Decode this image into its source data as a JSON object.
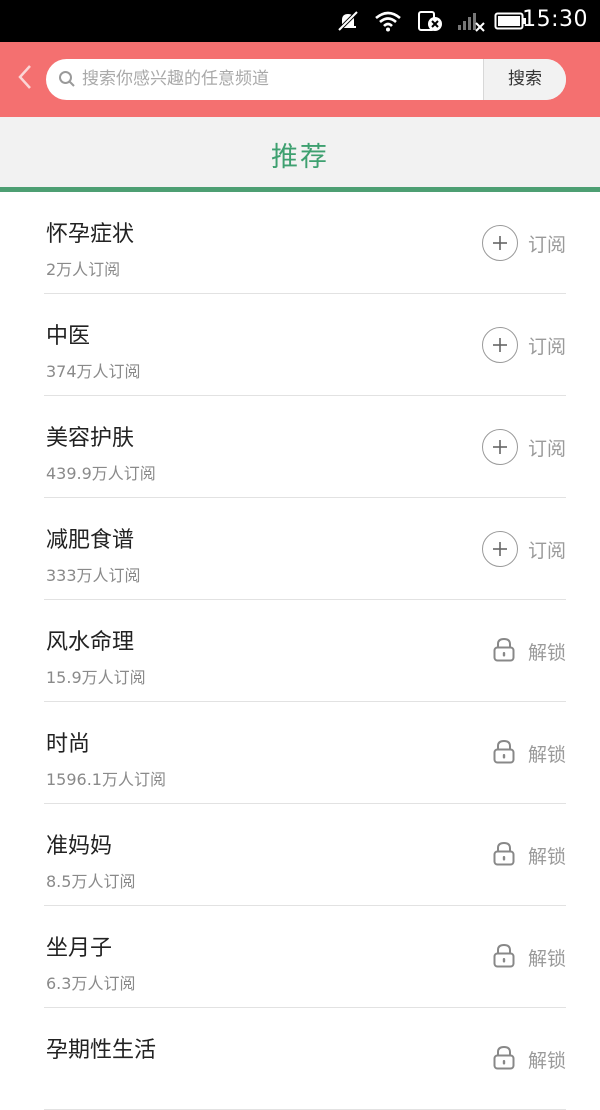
{
  "status_bar": {
    "time": "15:30",
    "icons": [
      "mute-icon",
      "wifi-icon",
      "sim-error-icon",
      "signal-icon",
      "battery-icon"
    ]
  },
  "header": {
    "search_placeholder": "搜索你感兴趣的任意频道",
    "search_button": "搜索",
    "bg_color": "#f47070"
  },
  "tab": {
    "label": "推荐",
    "color": "#3ea070"
  },
  "channels": [
    {
      "title": "怀孕症状",
      "subscribers": "2万人订阅",
      "action": "订阅",
      "action_icon": "plus-circle-icon"
    },
    {
      "title": "中医",
      "subscribers": "374万人订阅",
      "action": "订阅",
      "action_icon": "plus-circle-icon"
    },
    {
      "title": "美容护肤",
      "subscribers": "439.9万人订阅",
      "action": "订阅",
      "action_icon": "plus-circle-icon"
    },
    {
      "title": "减肥食谱",
      "subscribers": "333万人订阅",
      "action": "订阅",
      "action_icon": "plus-circle-icon"
    },
    {
      "title": "风水命理",
      "subscribers": "15.9万人订阅",
      "action": "解锁",
      "action_icon": "lock-icon"
    },
    {
      "title": "时尚",
      "subscribers": "1596.1万人订阅",
      "action": "解锁",
      "action_icon": "lock-icon"
    },
    {
      "title": "准妈妈",
      "subscribers": "8.5万人订阅",
      "action": "解锁",
      "action_icon": "lock-icon"
    },
    {
      "title": "坐月子",
      "subscribers": "6.3万人订阅",
      "action": "解锁",
      "action_icon": "lock-icon"
    },
    {
      "title": "孕期性生活",
      "subscribers": "",
      "action": "解锁",
      "action_icon": "lock-icon"
    }
  ]
}
